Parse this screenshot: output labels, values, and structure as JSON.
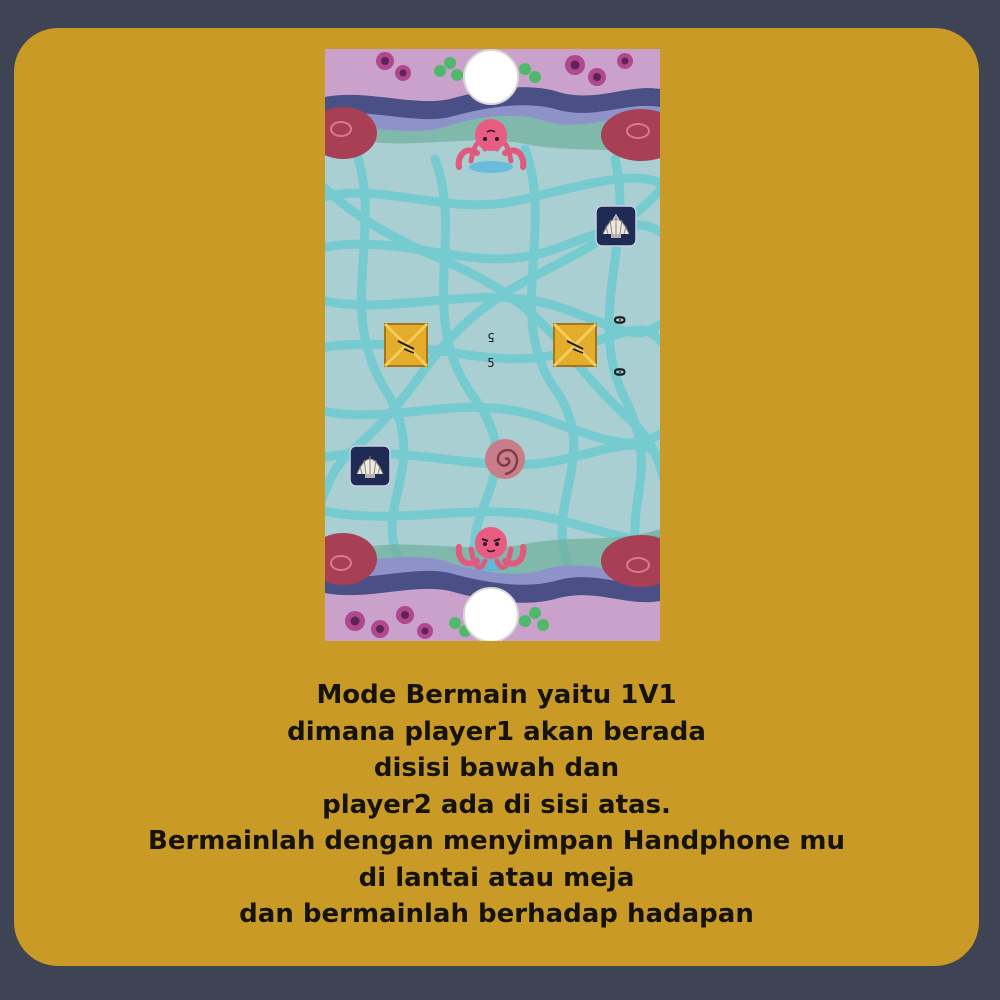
{
  "colors": {
    "frame": "#3e4454",
    "card": "#c99a25",
    "water": "#a9cfd3",
    "net": "#6ccbd0",
    "text": "#15130c"
  },
  "game": {
    "top_paddle": "white-goal-disc",
    "bottom_paddle": "white-goal-disc",
    "player2_icon": "pink-octopus-icon",
    "player1_icon": "pink-octopus-icon",
    "puck_icon": "spiral-shell-icon",
    "powerup_icon": "scallop-shell-icon",
    "obstacle_icon": "gold-crate-icon",
    "player2_score_upside": "5",
    "player1_score": "5",
    "side_score_top": "0",
    "side_score_bottom": "0"
  },
  "caption": {
    "line1": "Mode Bermain yaitu 1V1",
    "line2": "dimana player1 akan berada",
    "line3": "disisi bawah dan",
    "line4": "player2 ada di sisi atas.",
    "line5": "Bermainlah dengan menyimpan Handphone mu",
    "line6": "di lantai atau meja",
    "line7": "dan bermainlah berhadap hadapan"
  }
}
